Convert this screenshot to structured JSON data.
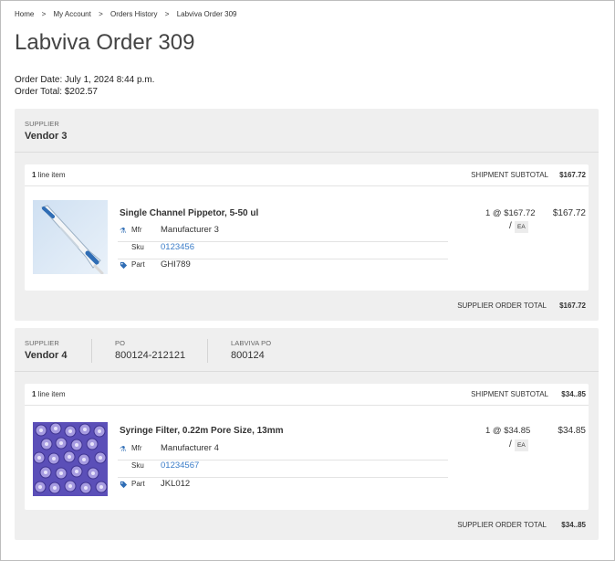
{
  "breadcrumb": {
    "items": [
      "Home",
      "My Account",
      "Orders History",
      "Labviva Order 309"
    ],
    "separator": ">"
  },
  "page": {
    "title": "Labviva Order 309",
    "order_date": "Order Date: July 1, 2024 8:44 p.m.",
    "order_total": "Order Total: $202.57"
  },
  "colors": {
    "link": "#3a7cc8",
    "icon": "#2f6db5",
    "panel": "#efefef"
  },
  "suppliers": [
    {
      "supplier_label": "SUPPLIER",
      "supplier_name": "Vendor 3",
      "shipment": {
        "line_count": "1",
        "line_count_suffix": "line item",
        "subtotal_label": "SHIPMENT SUBTOTAL",
        "subtotal_value": "$167.72",
        "item": {
          "name": "Single Channel Pippetor, 5-50 ul",
          "image": "pipette-product-image",
          "mfr_label": "Mfr",
          "mfr_value": "Manufacturer 3",
          "sku_label": "Sku",
          "sku_value": "0123456",
          "part_label": "Part",
          "part_value": "GHI789",
          "qty_price": "1 @ $167.72",
          "slash": "/",
          "uom": "EA",
          "line_total": "$167.72"
        }
      },
      "order_total_label": "SUPPLIER ORDER TOTAL",
      "order_total_value": "$167.72"
    },
    {
      "supplier_label": "SUPPLIER",
      "supplier_name": "Vendor 4",
      "po_label": "PO",
      "po_value": "800124-212121",
      "labviva_po_label": "LABVIVA PO",
      "labviva_po_value": "800124",
      "shipment": {
        "line_count": "1",
        "line_count_suffix": "line item",
        "subtotal_label": "SHIPMENT SUBTOTAL",
        "subtotal_value": "$34..85",
        "item": {
          "name": "Syringe Filter, 0.22m Pore Size, 13mm",
          "image": "syringe-filter-product-image",
          "mfr_label": "Mfr",
          "mfr_value": "Manufacturer 4",
          "sku_label": "Sku",
          "sku_value": "01234567",
          "part_label": "Part",
          "part_value": "JKL012",
          "qty_price": "1 @ $34.85",
          "slash": "/",
          "uom": "EA",
          "line_total": "$34.85"
        }
      },
      "order_total_label": "SUPPLIER ORDER TOTAL",
      "order_total_value": "$34..85"
    }
  ]
}
